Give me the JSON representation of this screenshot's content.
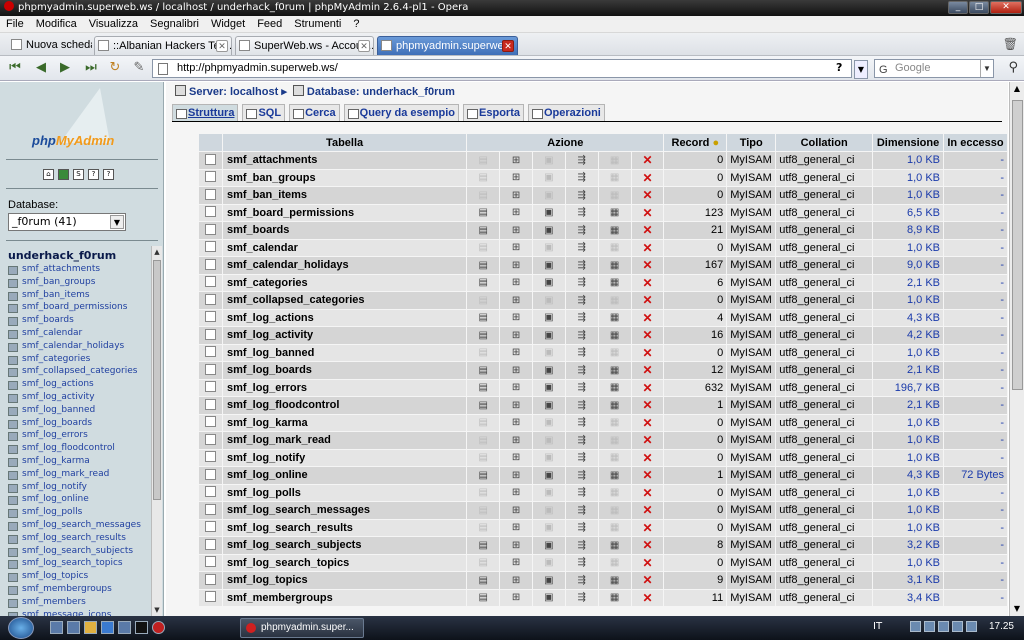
{
  "window": {
    "title": "phpmyadmin.superweb.ws / localhost / underhack_f0rum | phpMyAdmin 2.6.4-pl1 - Opera"
  },
  "menu": [
    "File",
    "Modifica",
    "Visualizza",
    "Segnalibri",
    "Widget",
    "Feed",
    "Strumenti",
    "?"
  ],
  "tabs": [
    {
      "label": "Nuova scheda"
    },
    {
      "label": "::Albanian Hackers Tea..."
    },
    {
      "label": "SuperWeb.ws - Accoun..."
    },
    {
      "label": "phpmyadmin.superwe..."
    }
  ],
  "address": {
    "url": "http://phpmyadmin.superweb.ws/",
    "help": "?"
  },
  "search": {
    "placeholder": "Google"
  },
  "sidebar": {
    "logo_a": "php",
    "logo_b": "MyAdmin",
    "db_label": "Database:",
    "db_selected": "_f0rum (41)",
    "db_name": "underhack_f0rum",
    "tables": [
      "smf_attachments",
      "smf_ban_groups",
      "smf_ban_items",
      "smf_board_permissions",
      "smf_boards",
      "smf_calendar",
      "smf_calendar_holidays",
      "smf_categories",
      "smf_collapsed_categories",
      "smf_log_actions",
      "smf_log_activity",
      "smf_log_banned",
      "smf_log_boards",
      "smf_log_errors",
      "smf_log_floodcontrol",
      "smf_log_karma",
      "smf_log_mark_read",
      "smf_log_notify",
      "smf_log_online",
      "smf_log_polls",
      "smf_log_search_messages",
      "smf_log_search_results",
      "smf_log_search_subjects",
      "smf_log_search_topics",
      "smf_log_topics",
      "smf_membergroups",
      "smf_members",
      "smf_message_icons"
    ]
  },
  "breadcrumb": {
    "server": "Server: localhost",
    "database": "Database: underhack_f0rum"
  },
  "pma_tabs": [
    "Struttura",
    "SQL",
    "Cerca",
    "Query da esempio",
    "Esporta",
    "Operazioni"
  ],
  "table_headers": {
    "tabella": "Tabella",
    "azione": "Azione",
    "record": "Record",
    "tipo": "Tipo",
    "collation": "Collation",
    "dimensione": "Dimensione",
    "eccesso": "In eccesso"
  },
  "rows": [
    {
      "name": "smf_attachments",
      "records": "0",
      "type": "MyISAM",
      "collation": "utf8_general_ci",
      "size": "1,0 KB",
      "overhead": "-"
    },
    {
      "name": "smf_ban_groups",
      "records": "0",
      "type": "MyISAM",
      "collation": "utf8_general_ci",
      "size": "1,0 KB",
      "overhead": "-"
    },
    {
      "name": "smf_ban_items",
      "records": "0",
      "type": "MyISAM",
      "collation": "utf8_general_ci",
      "size": "1,0 KB",
      "overhead": "-"
    },
    {
      "name": "smf_board_permissions",
      "records": "123",
      "type": "MyISAM",
      "collation": "utf8_general_ci",
      "size": "6,5 KB",
      "overhead": "-"
    },
    {
      "name": "smf_boards",
      "records": "21",
      "type": "MyISAM",
      "collation": "utf8_general_ci",
      "size": "8,9 KB",
      "overhead": "-"
    },
    {
      "name": "smf_calendar",
      "records": "0",
      "type": "MyISAM",
      "collation": "utf8_general_ci",
      "size": "1,0 KB",
      "overhead": "-"
    },
    {
      "name": "smf_calendar_holidays",
      "records": "167",
      "type": "MyISAM",
      "collation": "utf8_general_ci",
      "size": "9,0 KB",
      "overhead": "-"
    },
    {
      "name": "smf_categories",
      "records": "6",
      "type": "MyISAM",
      "collation": "utf8_general_ci",
      "size": "2,1 KB",
      "overhead": "-"
    },
    {
      "name": "smf_collapsed_categories",
      "records": "0",
      "type": "MyISAM",
      "collation": "utf8_general_ci",
      "size": "1,0 KB",
      "overhead": "-"
    },
    {
      "name": "smf_log_actions",
      "records": "4",
      "type": "MyISAM",
      "collation": "utf8_general_ci",
      "size": "4,3 KB",
      "overhead": "-"
    },
    {
      "name": "smf_log_activity",
      "records": "16",
      "type": "MyISAM",
      "collation": "utf8_general_ci",
      "size": "4,2 KB",
      "overhead": "-"
    },
    {
      "name": "smf_log_banned",
      "records": "0",
      "type": "MyISAM",
      "collation": "utf8_general_ci",
      "size": "1,0 KB",
      "overhead": "-"
    },
    {
      "name": "smf_log_boards",
      "records": "12",
      "type": "MyISAM",
      "collation": "utf8_general_ci",
      "size": "2,1 KB",
      "overhead": "-"
    },
    {
      "name": "smf_log_errors",
      "records": "632",
      "type": "MyISAM",
      "collation": "utf8_general_ci",
      "size": "196,7 KB",
      "overhead": "-"
    },
    {
      "name": "smf_log_floodcontrol",
      "records": "1",
      "type": "MyISAM",
      "collation": "utf8_general_ci",
      "size": "2,1 KB",
      "overhead": "-"
    },
    {
      "name": "smf_log_karma",
      "records": "0",
      "type": "MyISAM",
      "collation": "utf8_general_ci",
      "size": "1,0 KB",
      "overhead": "-"
    },
    {
      "name": "smf_log_mark_read",
      "records": "0",
      "type": "MyISAM",
      "collation": "utf8_general_ci",
      "size": "1,0 KB",
      "overhead": "-"
    },
    {
      "name": "smf_log_notify",
      "records": "0",
      "type": "MyISAM",
      "collation": "utf8_general_ci",
      "size": "1,0 KB",
      "overhead": "-"
    },
    {
      "name": "smf_log_online",
      "records": "1",
      "type": "MyISAM",
      "collation": "utf8_general_ci",
      "size": "4,3 KB",
      "overhead": "72 Bytes"
    },
    {
      "name": "smf_log_polls",
      "records": "0",
      "type": "MyISAM",
      "collation": "utf8_general_ci",
      "size": "1,0 KB",
      "overhead": "-"
    },
    {
      "name": "smf_log_search_messages",
      "records": "0",
      "type": "MyISAM",
      "collation": "utf8_general_ci",
      "size": "1,0 KB",
      "overhead": "-"
    },
    {
      "name": "smf_log_search_results",
      "records": "0",
      "type": "MyISAM",
      "collation": "utf8_general_ci",
      "size": "1,0 KB",
      "overhead": "-"
    },
    {
      "name": "smf_log_search_subjects",
      "records": "8",
      "type": "MyISAM",
      "collation": "utf8_general_ci",
      "size": "3,2 KB",
      "overhead": "-"
    },
    {
      "name": "smf_log_search_topics",
      "records": "0",
      "type": "MyISAM",
      "collation": "utf8_general_ci",
      "size": "1,0 KB",
      "overhead": "-"
    },
    {
      "name": "smf_log_topics",
      "records": "9",
      "type": "MyISAM",
      "collation": "utf8_general_ci",
      "size": "3,1 KB",
      "overhead": "-"
    },
    {
      "name": "smf_membergroups",
      "records": "11",
      "type": "MyISAM",
      "collation": "utf8_general_ci",
      "size": "3,4 KB",
      "overhead": "-"
    }
  ],
  "taskbar": {
    "task": "phpmyadmin.super...",
    "lang": "IT",
    "clock": "17.25"
  }
}
